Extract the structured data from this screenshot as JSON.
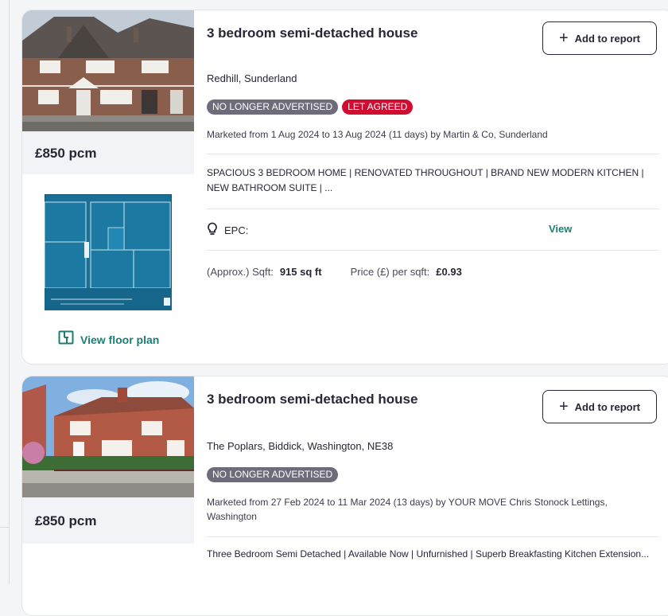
{
  "listings": [
    {
      "title": "3 bedroom semi-detached house",
      "add_label": "Add to report",
      "address": "Redhill, Sunderland",
      "badges": [
        "NO LONGER ADVERTISED",
        "LET AGREED"
      ],
      "marketed": "Marketed from 1 Aug 2024 to 13 Aug 2024 (11 days) by Martin & Co, Sunderland",
      "description": "SPACIOUS 3 BEDROOM HOME | RENOVATED THROUGHOUT | BRAND NEW MODERN KITCHEN | NEW BATHROOM SUITE | ...",
      "price": "£850 pcm",
      "epc_label": "EPC:",
      "epc_view": "View",
      "sqft_label": "(Approx.) Sqft:",
      "sqft_value": "915 sq ft",
      "ppsf_label": "Price (£) per sqft:",
      "ppsf_value": "£0.93",
      "floor_plan_link": "View floor plan"
    },
    {
      "title": "3 bedroom semi-detached house",
      "add_label": "Add to report",
      "address": "The Poplars, Biddick, Washington, NE38",
      "badges": [
        "NO LONGER ADVERTISED"
      ],
      "marketed": "Marketed from 27 Feb 2024 to 11 Mar 2024 (13 days) by YOUR MOVE Chris Stonock Lettings, Washington",
      "description": "Three Bedroom Semi Detached | Available Now | Unfurnished | Superb Breakfasting Kitchen Extension...",
      "price": "£850 pcm"
    }
  ],
  "colors": {
    "teal": "#1b7e75",
    "badge_grey": "#6e6c7b",
    "badge_red": "#d00c31",
    "floorplan_blue": "#1a6f96"
  },
  "icons": [
    "plus-icon",
    "lightbulb-icon",
    "floor-plan-icon"
  ]
}
